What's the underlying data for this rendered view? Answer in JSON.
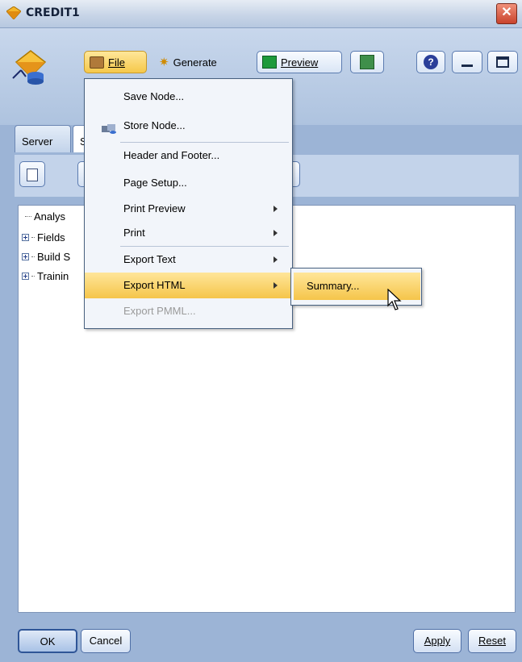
{
  "window": {
    "title": "CREDIT1",
    "close_icon": "close-icon"
  },
  "toolbar": {
    "file_label": "File",
    "generate_label": "Generate",
    "preview_label": "Preview"
  },
  "tabs": [
    {
      "label": "Server"
    },
    {
      "label": "S"
    }
  ],
  "tree": [
    {
      "label": "Analys",
      "expandable": false
    },
    {
      "label": "Fields",
      "expandable": true
    },
    {
      "label": "Build S",
      "expandable": true
    },
    {
      "label": "Trainin",
      "expandable": true
    }
  ],
  "file_menu": {
    "items": [
      {
        "label": "Save Node...",
        "has_submenu": false,
        "enabled": true
      },
      {
        "label": "Store Node...",
        "has_submenu": false,
        "enabled": true,
        "icon": "store-node-icon"
      },
      {
        "label": "Header and Footer...",
        "has_submenu": false,
        "enabled": true
      },
      {
        "label": "Page Setup...",
        "has_submenu": false,
        "enabled": true
      },
      {
        "label": "Print Preview",
        "has_submenu": true,
        "enabled": true
      },
      {
        "label": "Print",
        "has_submenu": true,
        "enabled": true
      },
      {
        "label": "Export Text",
        "has_submenu": true,
        "enabled": true
      },
      {
        "label": "Export HTML",
        "has_submenu": true,
        "enabled": true,
        "highlighted": true
      },
      {
        "label": "Export PMML...",
        "has_submenu": false,
        "enabled": false
      }
    ]
  },
  "submenu": {
    "items": [
      {
        "label": "Summary...",
        "highlighted": true
      }
    ]
  },
  "buttons": {
    "ok": "OK",
    "cancel": "Cancel",
    "apply": "Apply",
    "reset": "Reset"
  },
  "colors": {
    "highlight": "#f5c54a",
    "frame": "#9cb4d6",
    "close": "#c9432c"
  }
}
